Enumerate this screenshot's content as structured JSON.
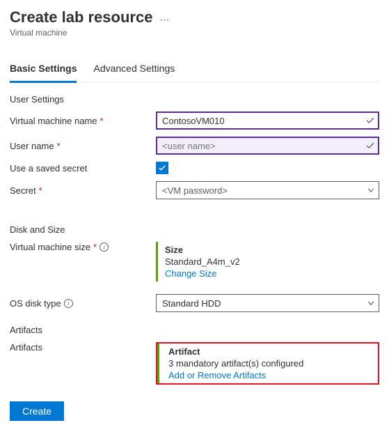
{
  "header": {
    "title": "Create lab resource",
    "subtitle": "Virtual machine"
  },
  "tabs": {
    "basic": "Basic Settings",
    "advanced": "Advanced Settings"
  },
  "user_settings": {
    "section_label": "User Settings",
    "vm_name_label": "Virtual machine name",
    "vm_name_value": "ContosoVM010",
    "user_name_label": "User name",
    "user_name_placeholder": "<user name>",
    "use_saved_secret_label": "Use a saved secret",
    "use_saved_secret_checked": true,
    "secret_label": "Secret",
    "secret_placeholder": "<VM password>"
  },
  "disk_size": {
    "section_label": "Disk and Size",
    "vm_size_label": "Virtual machine size",
    "size_title": "Size",
    "size_value": "Standard_A4m_v2",
    "change_size": "Change Size",
    "os_disk_label": "OS disk type",
    "os_disk_value": "Standard HDD"
  },
  "artifacts": {
    "section_label": "Artifacts",
    "row_label": "Artifacts",
    "block_title": "Artifact",
    "block_line": "3 mandatory artifact(s) configured",
    "block_link": "Add or Remove Artifacts"
  },
  "footer": {
    "create": "Create"
  }
}
